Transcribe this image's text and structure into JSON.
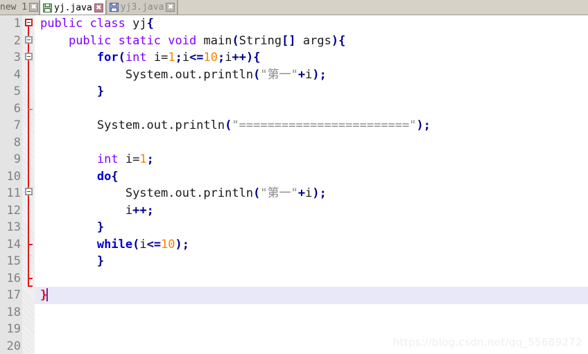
{
  "tabbar": {
    "tabs": [
      {
        "label": "new 1",
        "state": "partial-scrolled-out",
        "icon": "none",
        "close_icon": "close-icon",
        "close_style": "grey"
      },
      {
        "label": "yj.java",
        "state": "active",
        "icon": "floppy-disk-icon",
        "icon_color": "green",
        "close_icon": "close-icon",
        "close_style": "red"
      },
      {
        "label": "yj3.java",
        "state": "inactive",
        "icon": "floppy-disk-icon",
        "icon_color": "blue",
        "close_icon": "close-icon",
        "close_style": "grey"
      }
    ]
  },
  "editor": {
    "language": "java",
    "line_numbers": [
      1,
      2,
      3,
      4,
      5,
      6,
      7,
      8,
      9,
      10,
      11,
      12,
      13,
      14,
      15,
      16,
      17,
      18,
      19,
      20
    ],
    "current_line": 16,
    "cursor_line": 16,
    "lines": [
      {
        "n": 1,
        "text": "public class yj{"
      },
      {
        "n": 2,
        "text": "    public static void main(String[] args){"
      },
      {
        "n": 3,
        "text": "        for(int i=1;i<=10;i++){"
      },
      {
        "n": 4,
        "text": "            System.out.println(\"第一\"+i);"
      },
      {
        "n": 5,
        "text": "        }"
      },
      {
        "n": 6,
        "text": ""
      },
      {
        "n": 7,
        "text": "        System.out.println(\"========================\");"
      },
      {
        "n": 8,
        "text": ""
      },
      {
        "n": 9,
        "text": "        int i=1;"
      },
      {
        "n": 10,
        "text": "        do{"
      },
      {
        "n": 11,
        "text": "            System.out.println(\"第一\"+i);"
      },
      {
        "n": 12,
        "text": "            i++;"
      },
      {
        "n": 13,
        "text": "        }"
      },
      {
        "n": 14,
        "text": "        while(i<=10);"
      },
      {
        "n": 15,
        "text": "        }"
      },
      {
        "n": 16,
        "text": "}"
      },
      {
        "n": 17,
        "text": ""
      },
      {
        "n": 18,
        "text": ""
      },
      {
        "n": 19,
        "text": ""
      },
      {
        "n": 20,
        "text": ""
      }
    ],
    "tokens": {
      "l1": {
        "kw1": "public",
        "kw2": "class",
        "name": "yj",
        "brace": "{"
      },
      "l2": {
        "kw1": "public",
        "kw2": "static",
        "kw3": "void",
        "name": "main",
        "paren_open": "(",
        "type": "String",
        "brackets": "[]",
        "arg": "args",
        "paren_close": ")",
        "brace": "{"
      },
      "l3": {
        "kw": "for",
        "paren_open": "(",
        "type": "int",
        "var1": "i=",
        "num1": "1",
        "semi1": ";",
        "var2": "i",
        "op": "<=",
        "num2": "10",
        "semi2": ";",
        "var3": "i",
        "inc": "++",
        "paren_close": ")",
        "brace": "{"
      },
      "l4": {
        "call": "System.out.println",
        "paren_open": "(",
        "quote": "\"",
        "string": "第一",
        "plus": "+",
        "var": "i",
        "paren_close": ")",
        "semi": ";"
      },
      "l5": {
        "brace": "}"
      },
      "l7": {
        "call": "System.out.println",
        "paren_open": "(",
        "quote": "\"",
        "string": "========================",
        "paren_close": ")",
        "semi": ";"
      },
      "l9": {
        "type": "int",
        "var": "i=",
        "num": "1",
        "semi": ";"
      },
      "l10": {
        "kw": "do",
        "brace": "{"
      },
      "l11": {
        "call": "System.out.println",
        "paren_open": "(",
        "quote": "\"",
        "string": "第一",
        "plus": "+",
        "var": "i",
        "paren_close": ")",
        "semi": ";"
      },
      "l12": {
        "var": "i",
        "inc": "++",
        "semi": ";"
      },
      "l13": {
        "brace": "}"
      },
      "l14": {
        "kw": "while",
        "paren_open": "(",
        "var": "i",
        "op": "<=",
        "num": "10",
        "paren_close": ")",
        "semi": ";"
      },
      "l15": {
        "brace": "}"
      },
      "l16": {
        "brace": "}"
      }
    },
    "colors": {
      "keyword_purple": "#7f00ff",
      "keyword_blue_bold": "#0000d0",
      "punctuation": "#00008b",
      "number": "#ff8000",
      "string": "#8a8a8a",
      "plain_text": "#1a1a1a",
      "unmatched_brace": "#d01010",
      "gutter_bg": "#e4e4e4",
      "gutter_text": "#808080",
      "current_line_bg": "#e8e8f8",
      "fold_marker": "#e01b1b",
      "cursor": "#7b1fa2",
      "editor_bg": "#ffffff",
      "tabbar_bg": "#d6d2c8"
    }
  },
  "watermark": {
    "text": "https://blog.csdn.net/qq_55689272"
  }
}
